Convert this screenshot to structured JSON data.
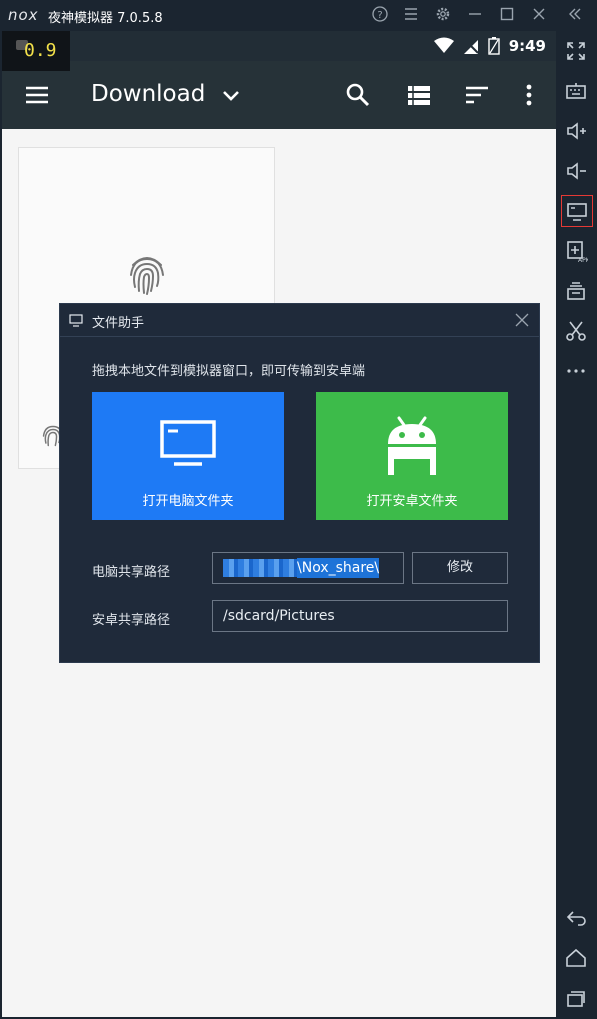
{
  "window": {
    "logo": "nox",
    "title": "夜神模拟器 7.0.5.8",
    "controls": [
      "help-icon",
      "menu-icon",
      "settings-icon",
      "minimize-icon",
      "maximize-icon",
      "close-icon",
      "collapse-icon"
    ]
  },
  "status_bar": {
    "fps": "0.9",
    "time": "9:49"
  },
  "app_bar": {
    "title": "Download"
  },
  "dialog": {
    "title": "文件助手",
    "hint": "拖拽本地文件到模拟器窗口，即可传输到安卓端",
    "open_pc_folder": "打开电脑文件夹",
    "open_android_folder": "打开安卓文件夹",
    "pc_share_label": "电脑共享路径",
    "pc_share_path": "\\Nox_share\\",
    "edit_button": "修改",
    "android_share_label": "安卓共享路径",
    "android_share_path": "/sdcard/Pictures"
  },
  "colors": {
    "pc_button": "#1e7af5",
    "android_button": "#3dbb4a",
    "app_bar": "#263238",
    "dialog_bg": "#1f2a3a"
  }
}
